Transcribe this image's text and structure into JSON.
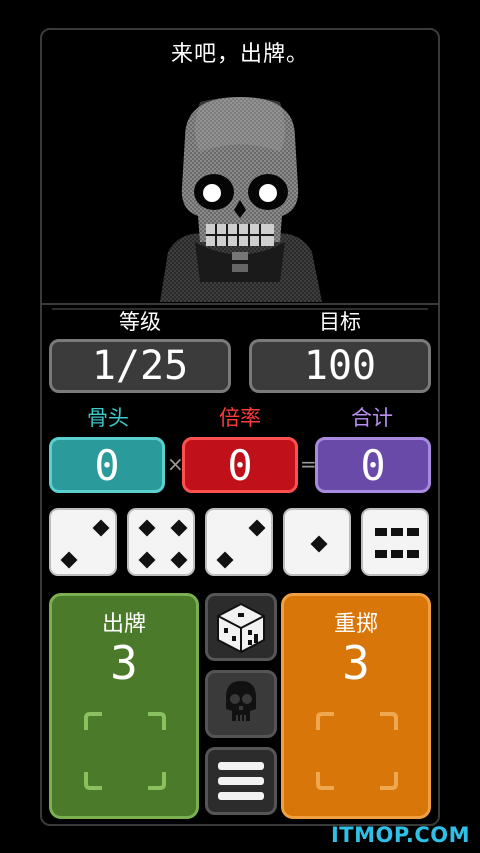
{
  "dialog": "来吧，出牌。",
  "level": {
    "label": "等级",
    "value": "1/25"
  },
  "target": {
    "label": "目标",
    "value": "100"
  },
  "bones": {
    "label": "骨头",
    "value": "0",
    "color": "#2a9a9a"
  },
  "mult": {
    "label": "倍率",
    "value": "0",
    "color": "#c0101a"
  },
  "total": {
    "label": "合计",
    "value": "0",
    "color": "#6a4aa8"
  },
  "operators": {
    "times": "×",
    "equals": "="
  },
  "dice": [
    2,
    4,
    2,
    1,
    6
  ],
  "play_card": {
    "title": "出牌",
    "count": "3",
    "color": "#4a7a2a"
  },
  "reroll_card": {
    "title": "重掷",
    "count": "3",
    "color": "#d8760a"
  },
  "side_buttons": [
    "dice-icon",
    "skull-icon",
    "menu-icon"
  ],
  "watermark": "ITMOP.COM"
}
